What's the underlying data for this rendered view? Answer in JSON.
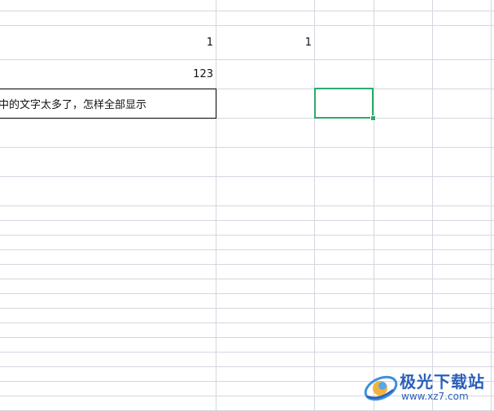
{
  "sheet": {
    "cells": {
      "row1_col1": "1",
      "row1_col2": "1",
      "row2_col1": "123",
      "row3_text": "中的文字太多了，怎样全部显示"
    }
  },
  "watermark": {
    "title": "极光下载站",
    "url": "www.xz7.com"
  },
  "colors": {
    "gridline": "#d4d7df",
    "active_cell_border": "#2ea96e",
    "watermark": "#2b5fb8"
  }
}
